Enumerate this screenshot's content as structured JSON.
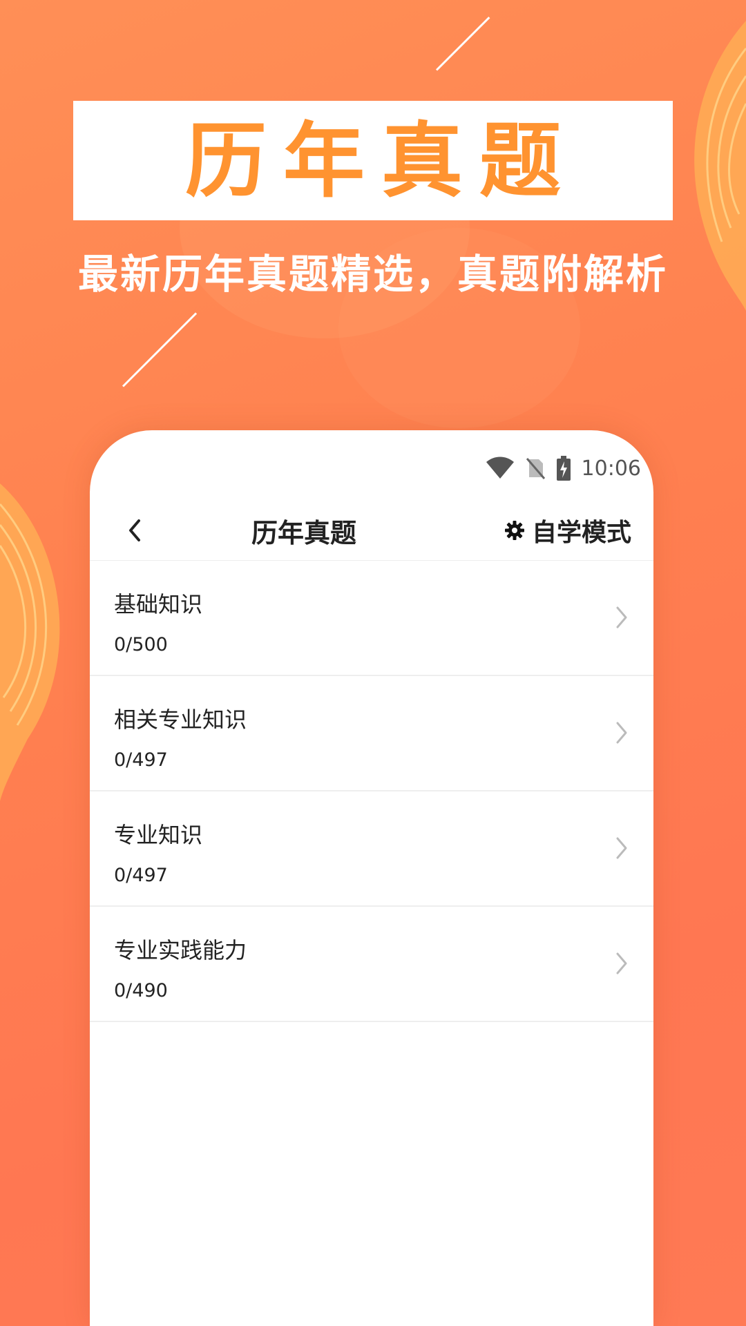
{
  "banner": {
    "title": "历年真题",
    "subtitle": "最新历年真题精选，真题附解析"
  },
  "status_bar": {
    "time": "10:06",
    "icons": [
      "wifi-icon",
      "no-sim-icon",
      "battery-charging-icon"
    ]
  },
  "app_bar": {
    "back_icon": "chevron-left-icon",
    "title": "历年真题",
    "mode_icon": "gear-icon",
    "mode_label": "自学模式"
  },
  "list": [
    {
      "title": "基础知识",
      "count": "0/500"
    },
    {
      "title": "相关专业知识",
      "count": "0/497"
    },
    {
      "title": "专业知识",
      "count": "0/497"
    },
    {
      "title": "专业实践能力",
      "count": "0/490"
    }
  ],
  "colors": {
    "background": "#ff8150",
    "accent": "#ff9330",
    "text": "#222222"
  }
}
